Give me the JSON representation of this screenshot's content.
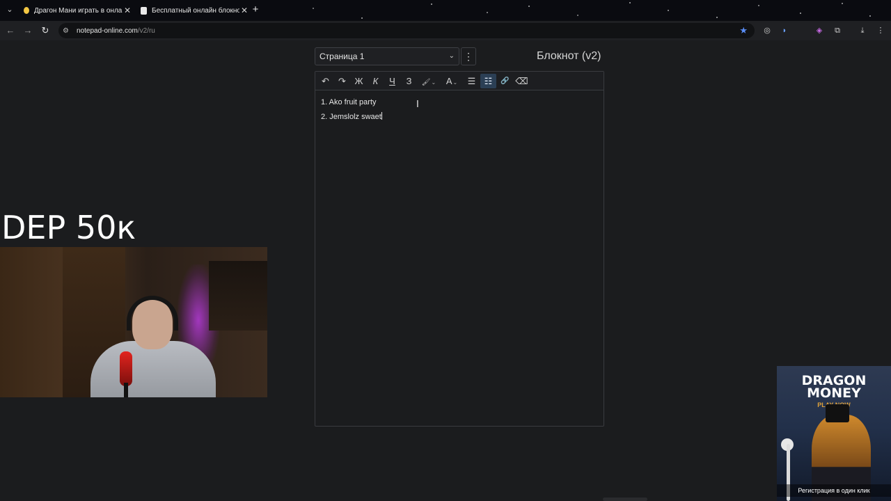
{
  "browser": {
    "tabs": [
      {
        "title": "Драгон Мани играть в онлай",
        "active": false
      },
      {
        "title": "Бесплатный онлайн блокнот",
        "active": true
      }
    ],
    "new_tab_symbol": "+",
    "close_symbol": "✕",
    "url_host": "notepad-online.com",
    "url_path": "/v2/ru",
    "icons": [
      "tab-search-icon",
      "back-icon",
      "forward-icon",
      "reload-icon",
      "site-settings-icon",
      "bookmark-star-icon",
      "extension-icons",
      "download-icon",
      "menu-icon"
    ]
  },
  "notepad": {
    "page_select_value": "Страница 1",
    "title": "Блокнот (v2)",
    "toolbar": {
      "undo": "↶",
      "redo": "↷",
      "bold": "Ж",
      "italic": "К",
      "underline": "Ч",
      "strike": "З",
      "highlight": "🖌",
      "font_color": "A",
      "bullet_list": "☰",
      "numbered_list": "☷",
      "link": "🔗",
      "clear_format": "⌫"
    },
    "lines": [
      {
        "num": "1.",
        "text": "Ako fruit party"
      },
      {
        "num": "2.",
        "text": "Jemslolz swaet"
      }
    ]
  },
  "overlay": {
    "caption": "DEP 50к"
  },
  "ad": {
    "brand_line1": "DRAGON",
    "brand_line2": "MONEY",
    "tagline": "PLAY NOW",
    "cta": "Регистрация в один клик"
  },
  "colors": {
    "background": "#1b1c1e",
    "active_tool": "#2b3f55",
    "bookmark_star": "#5a8ef7",
    "ad_accent": "#e0a23a"
  }
}
